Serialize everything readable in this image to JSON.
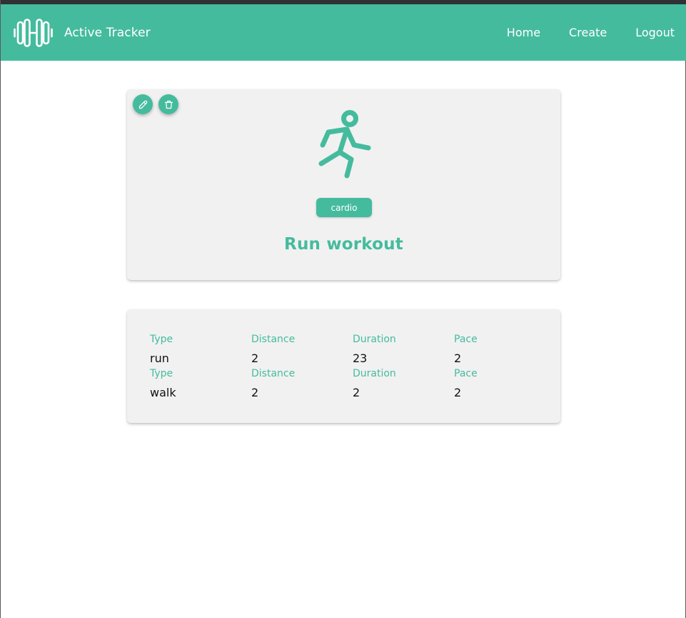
{
  "app": {
    "title": "Active Tracker",
    "logo_icon": "dumbbell-icon"
  },
  "nav": {
    "home": "Home",
    "create": "Create",
    "logout": "Logout"
  },
  "workout": {
    "edit_icon": "pencil-icon",
    "delete_icon": "trash-icon",
    "image_icon": "running-person-icon",
    "category": "cardio",
    "title": "Run workout"
  },
  "exercises": [
    {
      "type_label": "Type",
      "type": "run",
      "distance_label": "Distance",
      "distance": "2",
      "duration_label": "Duration",
      "duration": "23",
      "pace_label": "Pace",
      "pace": "2"
    },
    {
      "type_label": "Type",
      "type": "walk",
      "distance_label": "Distance",
      "distance": "2",
      "duration_label": "Duration",
      "duration": "2",
      "pace_label": "Pace",
      "pace": "2"
    }
  ],
  "colors": {
    "accent": "#45bb9e",
    "card_background": "#f1f1f1",
    "text": "#111111"
  }
}
